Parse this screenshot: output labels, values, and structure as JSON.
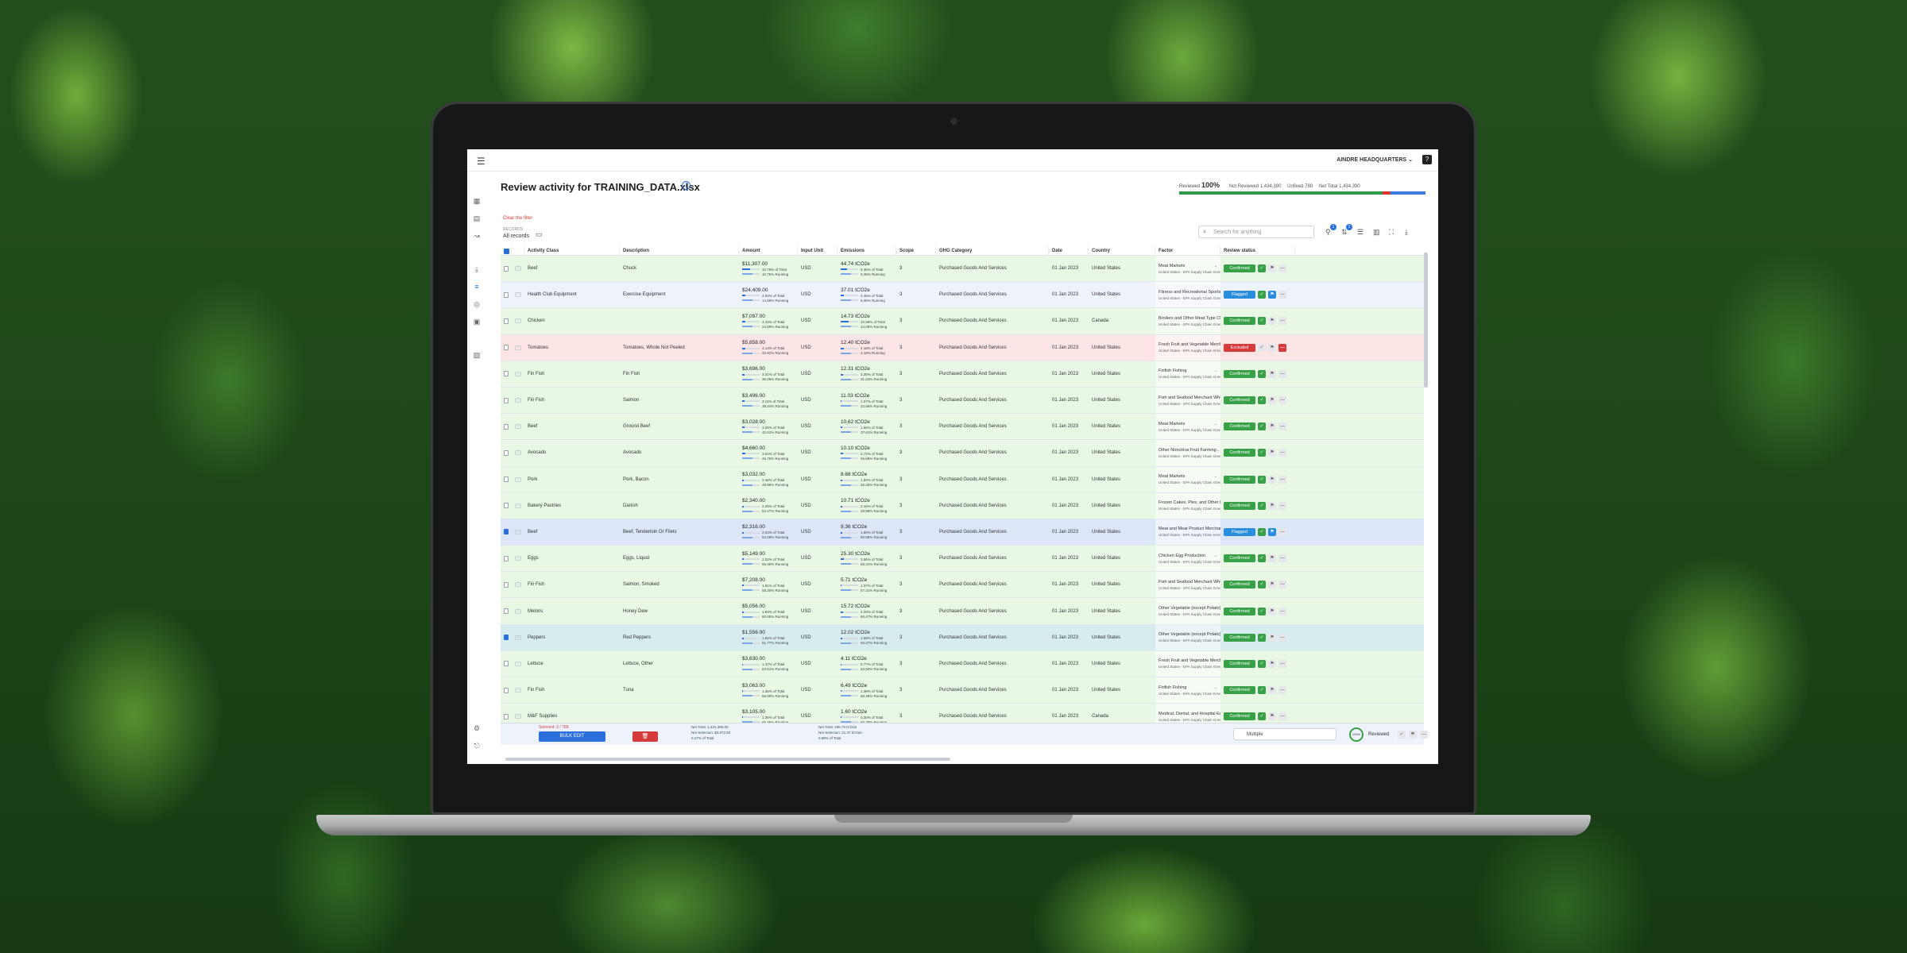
{
  "header": {
    "menu_icon": "hamburger-icon",
    "org": "AINDRE HEADQUARTERS",
    "help": "?"
  },
  "page": {
    "title": "Review activity for TRAINING_DATA.xlsx",
    "clear_filter": "Clear the filter",
    "records_label": "RECORDS",
    "records": "All records",
    "search_placeholder": "Search for anything"
  },
  "progress": {
    "label": "Reviewed",
    "percent": "100%",
    "not_reviewed": "Not Reviewed 1,434,390",
    "unfixed": "Unfixed 789",
    "net_total": "Net Total 1,434,390"
  },
  "columns": [
    "Activity Class",
    "Description",
    "Amount",
    "Input Unit",
    "Emissions",
    "Scope",
    "GHG Category",
    "Date",
    "Country",
    "Factor",
    "Review status"
  ],
  "rows": [
    {
      "state": "confirmed",
      "checked": false,
      "activity": "Beef",
      "desc": "Chuck",
      "amount": "$11,307.00",
      "a1": "10.76% of Total",
      "a2": "10.76% Running",
      "ap": 0.11,
      "unit": "USD",
      "emissions": "44.74 tCO2e",
      "e1": "9.35% of Total",
      "e2": "9.35% Running",
      "ep": 0.09,
      "scope": "3",
      "category": "Purchased Goods And Services",
      "date": "01 Jan 2023",
      "country": "United States",
      "factor": "Meat Markets",
      "factor_sub": "United States - EPA Supply Chain Greenhouse",
      "status": "Confirmed"
    },
    {
      "state": "flagged",
      "checked": false,
      "activity": "Health Club Equipment",
      "desc": "Exercise Equipment",
      "amount": "$24,409.00",
      "a1": "4.00% of Total",
      "a2": "14.69% Running",
      "ap": 0.04,
      "unit": "USD",
      "emissions": "37.01 tCO2e",
      "e1": "4.45% of Total",
      "e2": "6.35% Running",
      "ep": 0.04,
      "scope": "3",
      "category": "Purchased Goods And Services",
      "date": "01 Jan 2023",
      "country": "United States",
      "factor": "Fitness and Recreational Sports Centers",
      "factor_sub": "United States - EPA Supply Chain Greenhouse",
      "status": "Flagged"
    },
    {
      "state": "confirmed",
      "checked": false,
      "activity": "Chicken",
      "desc": "",
      "amount": "$7,097.00",
      "a1": "4.43% of Total",
      "a2": "24.09% Running",
      "ap": 0.04,
      "unit": "USD",
      "emissions": "14.73 tCO2e",
      "e1": "10.69% of Total",
      "e2": "34.09% Running",
      "ep": 0.11,
      "scope": "3",
      "category": "Purchased Goods And Services",
      "date": "01 Jan 2023",
      "country": "Canada",
      "factor": "Broilers and Other Meat Type Chicken P...",
      "factor_sub": "United States - EPA Supply Chain Greenhouse",
      "status": "Confirmed"
    },
    {
      "state": "excluded",
      "checked": false,
      "activity": "Tomatoes",
      "desc": "Tomatoes, Whole Not Peeled",
      "amount": "$5,858.00",
      "a1": "4.13% of Total",
      "a2": "32.91% Running",
      "ap": 0.04,
      "unit": "USD",
      "emissions": "12.40 tCO2e",
      "e1": "4.18% of Total",
      "e2": "4.18% Running",
      "ep": 0.04,
      "scope": "3",
      "category": "Purchased Goods And Services",
      "date": "01 Jan 2023",
      "country": "United States",
      "factor": "Fresh Fruit and Vegetable Merchant Wh...",
      "factor_sub": "United States - EPA Supply Chain Greenhouse",
      "status": "Excluded"
    },
    {
      "state": "confirmed",
      "checked": false,
      "activity": "Fin Fish",
      "desc": "Fin Fish",
      "amount": "$3,696.00",
      "a1": "3.31% of Total",
      "a2": "36.26% Running",
      "ap": 0.03,
      "unit": "USD",
      "emissions": "12.31 tCO2e",
      "e1": "3.30% of Total",
      "e2": "31.63% Running",
      "ep": 0.03,
      "scope": "3",
      "category": "Purchased Goods And Services",
      "date": "01 Jan 2023",
      "country": "United States",
      "factor": "Finfish Fishing",
      "factor_sub": "United States - EPA Supply Chain Greenhouse",
      "status": "Confirmed"
    },
    {
      "state": "confirmed",
      "checked": false,
      "activity": "Fin Fish",
      "desc": "Salmon",
      "amount": "$3,496.00",
      "a1": "3.11% of Total",
      "a2": "39.44% Running",
      "ap": 0.03,
      "unit": "USD",
      "emissions": "11.03 tCO2e",
      "e1": "1.07% of Total",
      "e2": "34.66% Running",
      "ep": 0.01,
      "scope": "3",
      "category": "Purchased Goods And Services",
      "date": "01 Jan 2023",
      "country": "United States",
      "factor": "Fish and Seafood Merchant Wholesalers",
      "factor_sub": "United States - EPA Supply Chain Greenhouse",
      "status": "Confirmed"
    },
    {
      "state": "confirmed",
      "checked": false,
      "activity": "Beef",
      "desc": "Ground Beef",
      "amount": "$3,028.00",
      "a1": "3.28% of Total",
      "a2": "42.61% Running",
      "ap": 0.03,
      "unit": "USD",
      "emissions": "10.62 tCO2e",
      "e1": "1.66% of Total",
      "e2": "37.61% Running",
      "ep": 0.02,
      "scope": "3",
      "category": "Purchased Goods And Services",
      "date": "01 Jan 2023",
      "country": "United States",
      "factor": "Meat Markets",
      "factor_sub": "United States - EPA Supply Chain Greenhouse",
      "status": "Confirmed"
    },
    {
      "state": "confirmed",
      "checked": false,
      "activity": "Avocado",
      "desc": "Avocado",
      "amount": "$4,660.00",
      "a1": "3.54% of Total",
      "a2": "46.75% Running",
      "ap": 0.04,
      "unit": "USD",
      "emissions": "10.10 tCO2e",
      "e1": "2.72% of Total",
      "e2": "40.68% Running",
      "ep": 0.03,
      "scope": "3",
      "category": "Purchased Goods And Services",
      "date": "01 Jan 2023",
      "country": "United States",
      "factor": "Other Noncitrus Fruit Farming",
      "factor_sub": "United States - EPA Supply Chain Greenhouse",
      "status": "Confirmed"
    },
    {
      "state": "confirmed",
      "checked": false,
      "activity": "Pork",
      "desc": "Pork, Bacon",
      "amount": "$3,032.00",
      "a1": "2.46% of Total",
      "a2": "49.99% Running",
      "ap": 0.02,
      "unit": "USD",
      "emissions": "8.68 tCO2e",
      "e1": "1.93% of Total",
      "e2": "45.26% Running",
      "ep": 0.02,
      "scope": "3",
      "category": "Purchased Goods And Services",
      "date": "01 Jan 2023",
      "country": "United States",
      "factor": "Meat Markets",
      "factor_sub": "United States - EPA Supply Chain Greenhouse",
      "status": "Confirmed"
    },
    {
      "state": "confirmed",
      "checked": false,
      "activity": "Bakery Pastries",
      "desc": "Danish",
      "amount": "$2,340.00",
      "a1": "2.26% of Total",
      "a2": "52.27% Running",
      "ap": 0.02,
      "unit": "USD",
      "emissions": "10.71 tCO2e",
      "e1": "2.16% of Total",
      "e2": "48.89% Running",
      "ep": 0.02,
      "scope": "3",
      "category": "Purchased Goods And Services",
      "date": "01 Jan 2023",
      "country": "United States",
      "factor": "Frozen Cakes, Pies, and Other Pastries",
      "factor_sub": "United States - EPA Supply Chain Greenhouse",
      "status": "Confirmed"
    },
    {
      "state": "selected",
      "checked": true,
      "activity": "Beef",
      "desc": "Beef, Tenderloin Or Filets",
      "amount": "$2,316.00",
      "a1": "2.03% of Total",
      "a2": "54.28% Running",
      "ap": 0.02,
      "unit": "USD",
      "emissions": "9.36 tCO2e",
      "e1": "1.65% of Total",
      "e2": "50.68% Running",
      "ep": 0.02,
      "scope": "3",
      "category": "Purchased Goods And Services",
      "date": "01 Jan 2023",
      "country": "United States",
      "factor": "Meat and Meat Product Merchant Whol...",
      "factor_sub": "United States - EPA Supply Chain Greenhouse",
      "status": "Flagged"
    },
    {
      "state": "confirmed",
      "checked": false,
      "activity": "Eggs",
      "desc": "Eggs, Liquid",
      "amount": "$5,149.00",
      "a1": "2.02% of Total",
      "a2": "56.30% Running",
      "ap": 0.02,
      "unit": "USD",
      "emissions": "25.30 tCO2e",
      "e1": "3.86% of Total",
      "e2": "55.21% Running",
      "ep": 0.04,
      "scope": "3",
      "category": "Purchased Goods And Services",
      "date": "01 Jan 2023",
      "country": "United States",
      "factor": "Chicken Egg Production",
      "factor_sub": "United States - EPA Supply Chain Greenhouse",
      "status": "Confirmed"
    },
    {
      "state": "confirmed",
      "checked": false,
      "activity": "Fin Fish",
      "desc": "Salmon, Smoked",
      "amount": "$7,208.00",
      "a1": "1.91% of Total",
      "a2": "58.30% Running",
      "ap": 0.02,
      "unit": "USD",
      "emissions": "5.71 tCO2e",
      "e1": "1.07% of Total",
      "e2": "57.31% Running",
      "ep": 0.01,
      "scope": "3",
      "category": "Purchased Goods And Services",
      "date": "01 Jan 2023",
      "country": "United States",
      "factor": "Fish and Seafood Merchant Wholesalers",
      "factor_sub": "United States - EPA Supply Chain Greenhouse",
      "status": "Confirmed"
    },
    {
      "state": "confirmed",
      "checked": false,
      "activity": "Melons",
      "desc": "Honey Dew",
      "amount": "$5,056.00",
      "a1": "1.83% of Total",
      "a2": "60.05% Running",
      "ap": 0.02,
      "unit": "USD",
      "emissions": "15.72 tCO2e",
      "e1": "3.33% of Total",
      "e2": "60.47% Running",
      "ep": 0.03,
      "scope": "3",
      "category": "Purchased Goods And Services",
      "date": "01 Jan 2023",
      "country": "United States",
      "factor": "Other Vegetable (except Potato) and M...",
      "factor_sub": "United States - EPA Supply Chain Greenhouse",
      "status": "Confirmed"
    },
    {
      "state": "selected-confirmed",
      "checked": true,
      "activity": "Peppers",
      "desc": "Red Peppers",
      "amount": "$1,556.00",
      "a1": "1.82% of Total",
      "a2": "61.77% Running",
      "ap": 0.02,
      "unit": "USD",
      "emissions": "12.02 tCO2e",
      "e1": "1.69% of Total",
      "e2": "62.27% Running",
      "ep": 0.02,
      "scope": "3",
      "category": "Purchased Goods And Services",
      "date": "01 Jan 2023",
      "country": "United States",
      "factor": "Other Vegetable (except Potato) and M...",
      "factor_sub": "United States - EPA Supply Chain Greenhouse",
      "status": "Confirmed"
    },
    {
      "state": "confirmed",
      "checked": false,
      "activity": "Lettuce",
      "desc": "Lettuce, Other",
      "amount": "$3,630.00",
      "a1": "1.37% of Total",
      "a2": "63.61% Running",
      "ap": 0.01,
      "unit": "USD",
      "emissions": "4.11 tCO2e",
      "e1": "0.77% of Total",
      "e2": "63.50% Running",
      "ep": 0.01,
      "scope": "3",
      "category": "Purchased Goods And Services",
      "date": "01 Jan 2023",
      "country": "United States",
      "factor": "Fresh Fruit and Vegetable Merchant Wh...",
      "factor_sub": "United States - EPA Supply Chain Greenhouse",
      "status": "Confirmed"
    },
    {
      "state": "confirmed",
      "checked": false,
      "activity": "Fin Fish",
      "desc": "Tuna",
      "amount": "$3,063.00",
      "a1": "1.36% of Total",
      "a2": "65.00% Running",
      "ap": 0.01,
      "unit": "USD",
      "emissions": "6.49 tCO2e",
      "e1": "1.38% of Total",
      "e2": "65.48% Running",
      "ep": 0.01,
      "scope": "3",
      "category": "Purchased Goods And Services",
      "date": "01 Jan 2023",
      "country": "United States",
      "factor": "Finfish Fishing",
      "factor_sub": "United States - EPA Supply Chain Greenhouse",
      "status": "Confirmed"
    },
    {
      "state": "confirmed",
      "checked": false,
      "activity": "M&F Supplies",
      "desc": "",
      "amount": "$3,105.00",
      "a1": "1.36% of Total",
      "a2": "66.36% Running",
      "ap": 0.01,
      "unit": "USD",
      "emissions": "1.60 tCO2e",
      "e1": "0.30% of Total",
      "e2": "65.78% Running",
      "ep": 0.01,
      "scope": "3",
      "category": "Purchased Goods And Services",
      "date": "01 Jan 2023",
      "country": "Canada",
      "factor": "Medical, Dental, and Hospital Equipme...",
      "factor_sub": "United States - EPA Supply Chain Greenhouse",
      "status": "Confirmed"
    }
  ],
  "footer": {
    "selected": "Selected: 2 / 789",
    "bulk_edit": "BULK EDIT",
    "amount_total": "Net Total: 1,434,390.00",
    "amount_sel": "Net Selection: $3,872.00",
    "amount_pct": "0.27% of Total",
    "em_total": "Net Total: 336.75 tCO2e",
    "em_sel": "Net Selection: 21.37 tCO2e",
    "em_pct": "0.88% of Total",
    "multiple": "Multiple",
    "ring": "100%",
    "reviewed": "Reviewed"
  },
  "colors": {
    "confirmed": "#38a046",
    "flagged": "#2a8ddc",
    "excluded": "#d63b3b",
    "accent": "#2a6fdc"
  }
}
